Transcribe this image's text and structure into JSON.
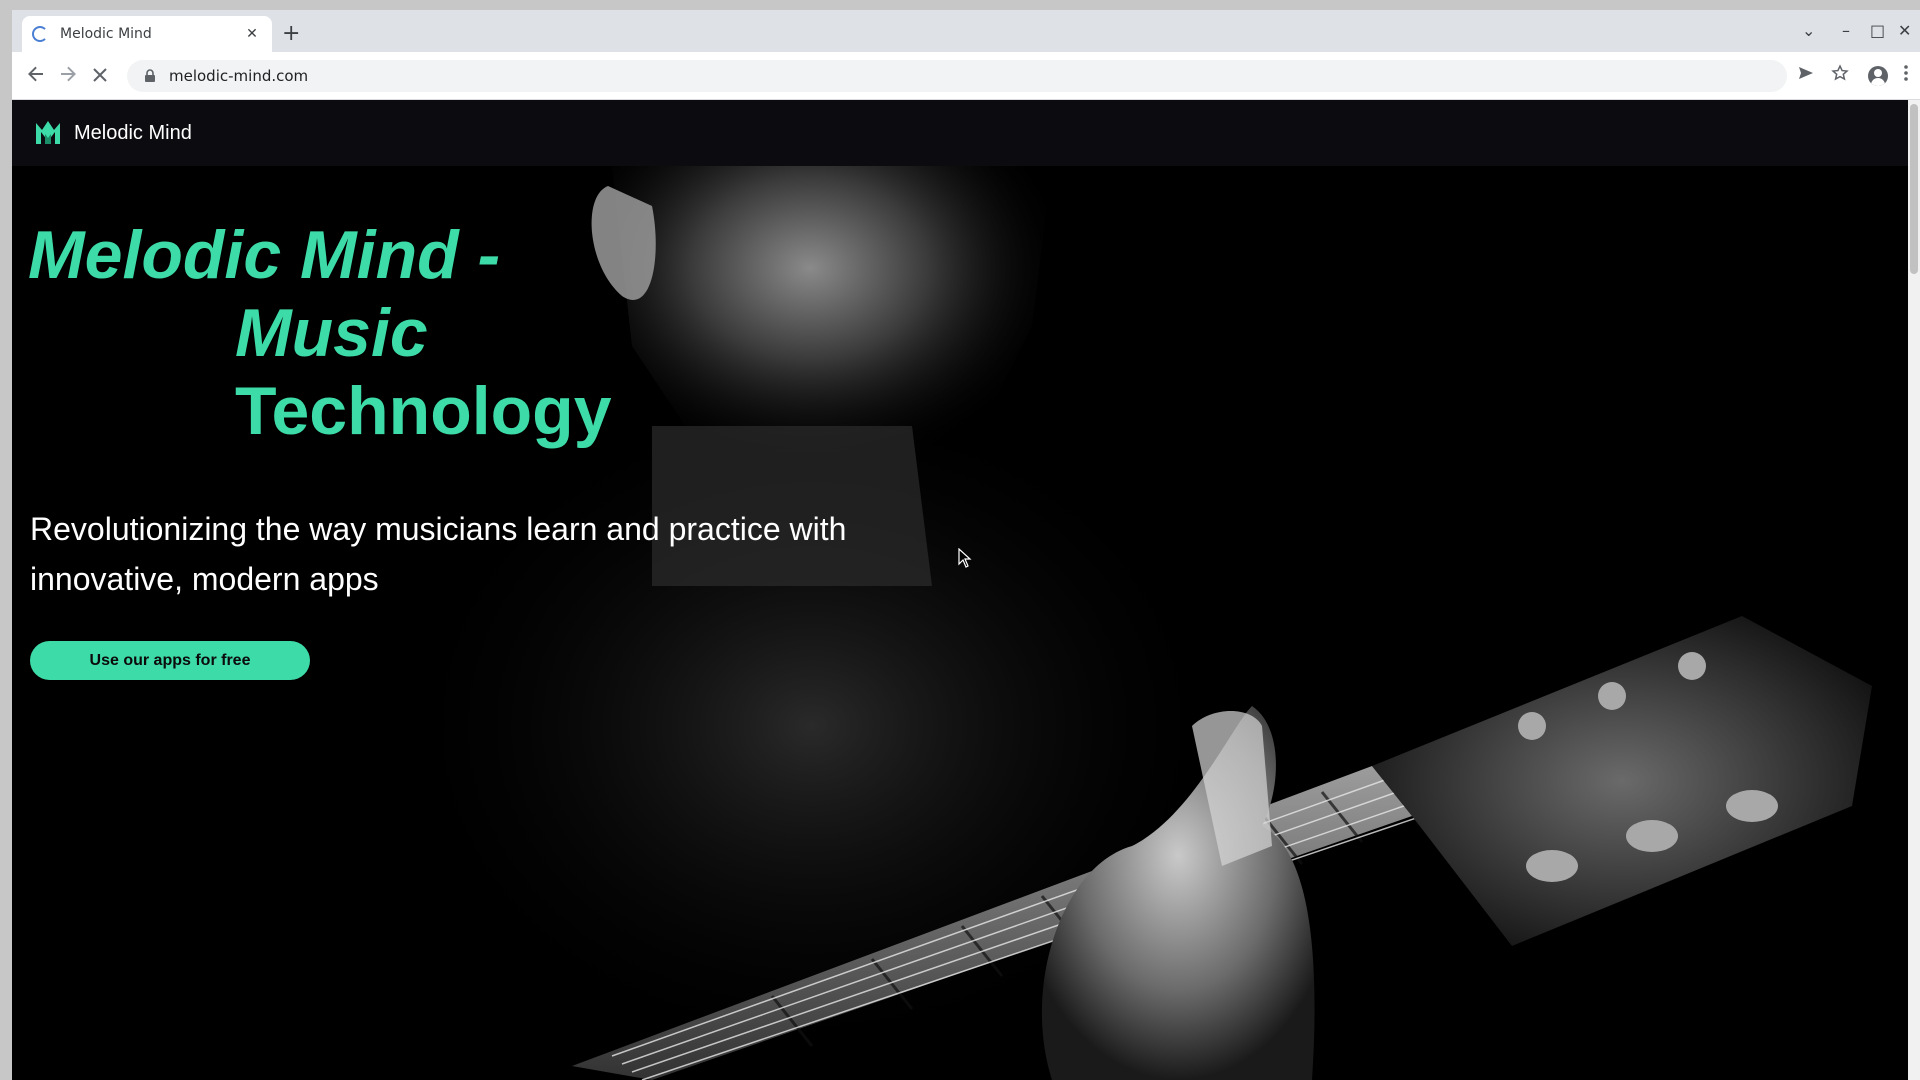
{
  "browser": {
    "tab_title": "Melodic Mind",
    "tab_close": "✕",
    "new_tab": "+",
    "url": "melodic-mind.com",
    "window_controls": {
      "tabs_menu": "⌄",
      "minimize": "–",
      "maximize": "□",
      "close": "✕"
    }
  },
  "site": {
    "brand": "Melodic Mind",
    "hero": {
      "title_line1": "Melodic Mind -",
      "title_line2": "Music",
      "title_line3": "Technology",
      "subtitle": "Revolutionizing the way musicians learn and practice with innovative, modern apps",
      "cta_label": "Use our apps for free"
    }
  },
  "colors": {
    "accent": "#3ddba7",
    "header_bg": "#0c0b10",
    "hero_bg": "#000000"
  },
  "icons": [
    "back-arrow-icon",
    "forward-arrow-icon",
    "stop-loading-icon",
    "lock-icon",
    "send-icon",
    "star-icon",
    "profile-icon",
    "kebab-menu-icon",
    "melodic-mind-logo-icon"
  ]
}
